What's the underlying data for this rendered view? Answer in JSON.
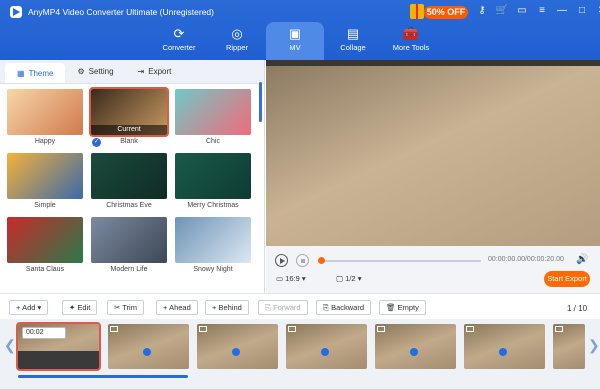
{
  "app": {
    "title": "AnyMP4 Video Converter Ultimate (Unregistered)",
    "promo": "50% OFF"
  },
  "nav": [
    "Converter",
    "Ripper",
    "MV",
    "Collage",
    "More Tools"
  ],
  "subtabs": [
    "Theme",
    "Setting",
    "Export"
  ],
  "themes": [
    {
      "label": "Happy",
      "colors": [
        "#f7d7a8",
        "#d07a4d"
      ]
    },
    {
      "label": "Blank",
      "colors": [
        "#3b2a1c",
        "#c79a62"
      ],
      "current": "Current"
    },
    {
      "label": "Chic",
      "colors": [
        "#6fc9c8",
        "#f06b7a"
      ]
    },
    {
      "label": "Simple",
      "colors": [
        "#f5b23a",
        "#3a6aa8"
      ]
    },
    {
      "label": "Christmas Eve",
      "colors": [
        "#1b4b3c",
        "#0f2b26"
      ]
    },
    {
      "label": "Merry Christmas",
      "colors": [
        "#1a5a4a",
        "#0e3b33"
      ]
    },
    {
      "label": "Santa Claus",
      "colors": [
        "#c72a2a",
        "#2b7a4b"
      ]
    },
    {
      "label": "Modern Life",
      "colors": [
        "#7c8aa0",
        "#3d4856"
      ]
    },
    {
      "label": "Snowy Night",
      "colors": [
        "#6e93b6",
        "#dce8f3"
      ]
    }
  ],
  "player": {
    "time": "00:00:00.00/00:00:20.00",
    "ratio": "16:9",
    "page": "1/2",
    "export": "Start Export"
  },
  "toolbar": {
    "add": "Add",
    "edit": "Edit",
    "trim": "Trim",
    "ahead": "Ahead",
    "behind": "Behind",
    "forward": "Forward",
    "backward": "Backward",
    "empty": "Empty",
    "counter": "1 / 10"
  },
  "clip": {
    "duration": "00:02"
  }
}
